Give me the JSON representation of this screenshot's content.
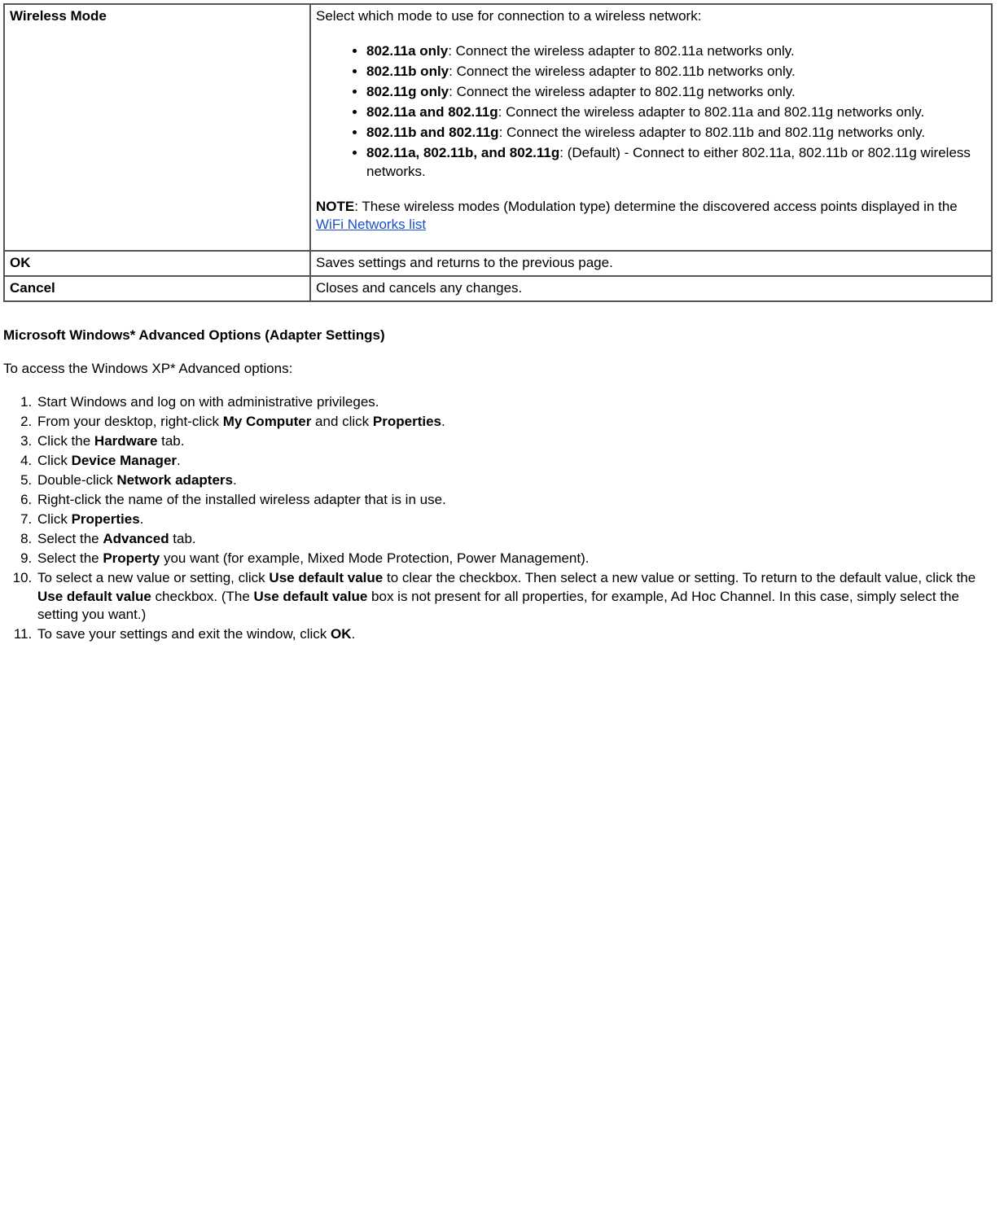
{
  "table": {
    "rows": [
      {
        "label": "Wireless Mode",
        "intro": "Select which mode to use for connection to a wireless network:",
        "items": [
          {
            "b": "802.11a only",
            "t": ": Connect the wireless adapter to 802.11a networks only."
          },
          {
            "b": "802.11b only",
            "t": ": Connect the wireless adapter to 802.11b networks only."
          },
          {
            "b": "802.11g only",
            "t": ": Connect the wireless adapter to 802.11g networks only."
          },
          {
            "b": "802.11a and 802.11g",
            "t": ": Connect the wireless adapter to 802.11a and 802.11g networks only."
          },
          {
            "b": "802.11b and 802.11g",
            "t": ": Connect the wireless adapter to 802.11b and 802.11g networks only."
          },
          {
            "b": "802.11a, 802.11b, and 802.11g",
            "t": ": (Default) - Connect to either 802.11a, 802.11b or 802.11g wireless networks."
          }
        ],
        "note_b": "NOTE",
        "note_t": ": These wireless modes (Modulation type) determine the discovered access points displayed in the ",
        "note_link": "WiFi Networks list"
      },
      {
        "label": "OK",
        "desc": "Saves settings and returns to the previous page."
      },
      {
        "label": "Cancel",
        "desc": "Closes and cancels any changes."
      }
    ]
  },
  "section_heading": "Microsoft Windows* Advanced Options (Adapter Settings)",
  "lead": "To access the Windows XP* Advanced options:",
  "steps": [
    {
      "pre": "Start Windows and log on with administrative privileges."
    },
    {
      "pre": "From your desktop, right-click ",
      "b1": "My Computer",
      "mid": " and click ",
      "b2": "Properties",
      "post": "."
    },
    {
      "pre": "Click the ",
      "b1": "Hardware",
      "post": " tab."
    },
    {
      "pre": "Click ",
      "b1": "Device Manager",
      "post": "."
    },
    {
      "pre": "Double-click ",
      "b1": "Network adapters",
      "post": "."
    },
    {
      "pre": "Right-click the name of the installed wireless adapter that is in use."
    },
    {
      "pre": "Click ",
      "b1": "Properties",
      "post": "."
    },
    {
      "pre": "Select the ",
      "b1": "Advanced",
      "post": " tab."
    },
    {
      "pre": "Select the ",
      "b1": "Property",
      "post": " you want (for example, Mixed Mode Protection, Power Management)."
    },
    {
      "pre": "To select a new value or setting, click ",
      "b1": "Use default value",
      "mid": " to clear the checkbox. Then select a new value or setting. To return to the default value, click the ",
      "b2": "Use default value",
      "mid2": " checkbox. (The ",
      "b3": "Use default value",
      "post": " box is not present for all properties, for example, Ad Hoc Channel. In this case, simply select the setting you want.)"
    },
    {
      "pre": "To save your settings and exit the window, click ",
      "b1": "OK",
      "post": "."
    }
  ]
}
